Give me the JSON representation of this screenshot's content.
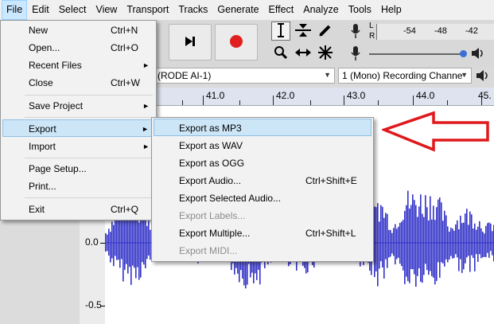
{
  "menubar": {
    "items": [
      "File",
      "Edit",
      "Select",
      "View",
      "Transport",
      "Tracks",
      "Generate",
      "Effect",
      "Analyze",
      "Tools",
      "Help"
    ]
  },
  "meter": {
    "channel_l": "L",
    "channel_r": "R",
    "ticks": [
      "-54",
      "-48",
      "-42"
    ]
  },
  "devices": {
    "input_device": "(RODE AI-1)",
    "channels": "1 (Mono) Recording Channe"
  },
  "ruler": {
    "labels": [
      "41.0",
      "42.0",
      "43.0",
      "44.0",
      "45."
    ]
  },
  "track": {
    "y_labels": [
      "0.0",
      "-0.5"
    ]
  },
  "file_menu": {
    "items": [
      {
        "label": "New",
        "shortcut": "Ctrl+N"
      },
      {
        "label": "Open...",
        "shortcut": "Ctrl+O"
      },
      {
        "label": "Recent Files",
        "submenu": true
      },
      {
        "label": "Close",
        "shortcut": "Ctrl+W"
      },
      {
        "label": "Save Project",
        "submenu": true
      },
      {
        "label": "Export",
        "submenu": true
      },
      {
        "label": "Import",
        "submenu": true
      },
      {
        "label": "Page Setup..."
      },
      {
        "label": "Print..."
      },
      {
        "label": "Exit",
        "shortcut": "Ctrl+Q"
      }
    ]
  },
  "export_menu": {
    "items": [
      {
        "label": "Export as MP3"
      },
      {
        "label": "Export as WAV"
      },
      {
        "label": "Export as OGG"
      },
      {
        "label": "Export Audio...",
        "shortcut": "Ctrl+Shift+E"
      },
      {
        "label": "Export Selected Audio..."
      },
      {
        "label": "Export Labels...",
        "disabled": true
      },
      {
        "label": "Export Multiple...",
        "shortcut": "Ctrl+Shift+L"
      },
      {
        "label": "Export MIDI...",
        "disabled": true
      }
    ]
  },
  "colors": {
    "waveform": "#3232c8",
    "arrow": "#e0181c",
    "highlight": "#cde6f7"
  },
  "icons": {
    "play_toolbar": [
      "skip-end-icon",
      "record-icon"
    ],
    "tools": [
      "selection-tool-icon",
      "envelope-tool-icon",
      "draw-tool-icon",
      "zoom-tool-icon",
      "timeshift-tool-icon",
      "multi-tool-icon"
    ],
    "meter": [
      "microphone-icon",
      "speaker-icon"
    ]
  }
}
